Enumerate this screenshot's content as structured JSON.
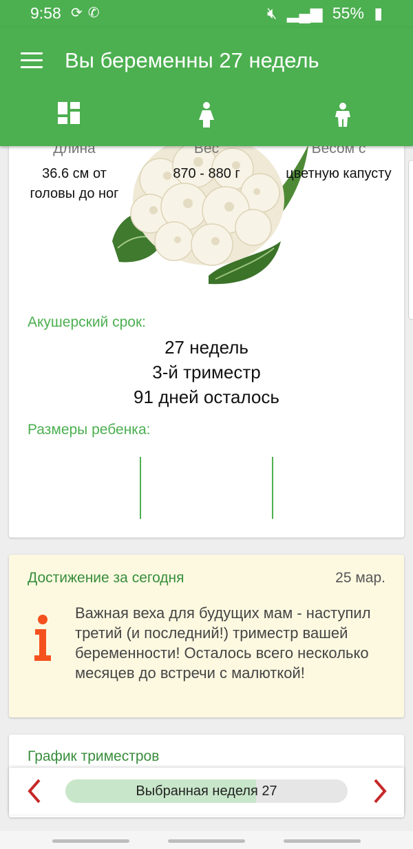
{
  "status_bar": {
    "time": "9:58",
    "battery": "55%",
    "left_icons": [
      "sync-icon",
      "phone-icon"
    ],
    "right_icons": [
      "mute-icon",
      "data-icon",
      "signal-icon",
      "battery-icon"
    ]
  },
  "app_bar": {
    "title": "Вы беременны 27 недель",
    "color": "#4caf50",
    "tabs": [
      {
        "icon": "dashboard-icon"
      },
      {
        "icon": "mother-icon"
      },
      {
        "icon": "baby-icon"
      }
    ]
  },
  "size_card": {
    "image": "cauliflower-image",
    "term_label": "Акушерский срок:",
    "term_lines": [
      "27 недель",
      "3-й триместр",
      "91 дней осталось"
    ],
    "sizes_label": "Размеры ребенка:",
    "columns": [
      {
        "head": "Длина",
        "value": "36.6 см от головы до ног"
      },
      {
        "head": "Вес",
        "value": "870 - 880 г"
      },
      {
        "head": "Весом с",
        "value": "цветную капусту"
      }
    ]
  },
  "achievement": {
    "title": "Достижение за сегодня",
    "date": "25 мар.",
    "text": "Важная веха для будущих мам - наступил третий (и последний!) триместр вашей беременности! Осталось всего несколько месяцев до встречи с малюткой!",
    "icon": "info-icon",
    "accent": "#f4511e"
  },
  "trimester_card": {
    "title": "График триместров"
  },
  "week_selector": {
    "label": "Выбранная неделя 27",
    "progress_fraction": 0.675,
    "arrow_color": "#c62828"
  }
}
